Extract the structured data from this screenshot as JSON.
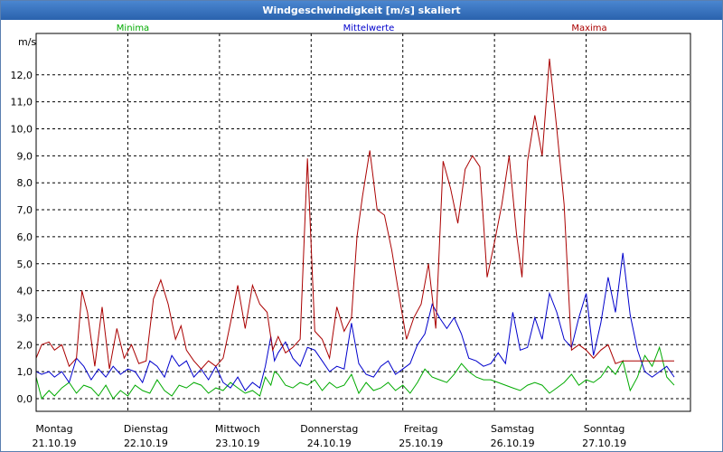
{
  "chart_data": {
    "type": "line",
    "title": "Windgeschwindigkeit [m/s] skaliert",
    "ylabel": "m/s",
    "ylim": [
      0,
      13
    ],
    "yticks": [
      "0,0",
      "1,0",
      "2,0",
      "3,0",
      "4,0",
      "5,0",
      "6,0",
      "7,0",
      "8,0",
      "9,0",
      "10,0",
      "11,0",
      "12,0"
    ],
    "xlim": [
      0,
      7
    ],
    "x_ticks": [
      {
        "day": "Montag",
        "date": "21.10.19"
      },
      {
        "day": "Dienstag",
        "date": "22.10.19"
      },
      {
        "day": "Mittwoch",
        "date": "23.10.19"
      },
      {
        "day": "Donnerstag",
        "date": "24.10.19"
      },
      {
        "day": "Freitag",
        "date": "25.10.19"
      },
      {
        "day": "Samstag",
        "date": "26.10.19"
      },
      {
        "day": "Sonntag",
        "date": "27.10.19"
      }
    ],
    "grid": true,
    "legend_placement": "top",
    "series": [
      {
        "name": "Minima",
        "color": "#00aa00",
        "x": [
          0,
          0.06,
          0.14,
          0.2,
          0.28,
          0.36,
          0.44,
          0.52,
          0.6,
          0.68,
          0.76,
          0.84,
          0.92,
          1,
          1.08,
          1.16,
          1.24,
          1.32,
          1.4,
          1.48,
          1.56,
          1.64,
          1.72,
          1.8,
          1.88,
          1.96,
          2.04,
          2.12,
          2.2,
          2.28,
          2.36,
          2.44,
          2.5,
          2.56,
          2.6,
          2.64,
          2.72,
          2.8,
          2.88,
          2.96,
          3.04,
          3.12,
          3.2,
          3.28,
          3.36,
          3.44,
          3.52,
          3.6,
          3.68,
          3.76,
          3.84,
          3.92,
          4,
          4.08,
          4.16,
          4.24,
          4.32,
          4.4,
          4.48,
          4.56,
          4.64,
          4.72,
          4.8,
          4.88,
          4.96,
          5.04,
          5.12,
          5.2,
          5.28,
          5.36,
          5.44,
          5.52,
          5.6,
          5.68,
          5.76,
          5.84,
          5.92,
          6,
          6.08,
          6.16,
          6.24,
          6.32,
          6.4,
          6.48,
          6.56,
          6.64,
          6.72,
          6.8,
          6.88,
          6.96
        ],
        "y": [
          0.8,
          0,
          0.3,
          0.1,
          0.4,
          0.6,
          0.2,
          0.5,
          0.4,
          0.1,
          0.5,
          0,
          0.3,
          0.1,
          0.5,
          0.3,
          0.2,
          0.7,
          0.3,
          0.1,
          0.5,
          0.4,
          0.6,
          0.5,
          0.2,
          0.4,
          0.3,
          0.6,
          0.4,
          0.2,
          0.3,
          0.1,
          0.8,
          0.5,
          1.0,
          0.9,
          0.5,
          0.4,
          0.6,
          0.5,
          0.7,
          0.3,
          0.6,
          0.4,
          0.5,
          0.9,
          0.2,
          0.6,
          0.3,
          0.4,
          0.6,
          0.3,
          0.5,
          0.2,
          0.6,
          1.1,
          0.8,
          0.7,
          0.6,
          0.9,
          1.3,
          1.0,
          0.8,
          0.7,
          0.7,
          0.6,
          0.5,
          0.4,
          0.3,
          0.5,
          0.6,
          0.5,
          0.2,
          0.4,
          0.6,
          0.9,
          0.5,
          0.7,
          0.6,
          0.8,
          1.2,
          0.9,
          1.4,
          0.3,
          0.8,
          1.6,
          1.2,
          1.9,
          0.8,
          0.5
        ]
      },
      {
        "name": "Mittelwerte",
        "color": "#0000cc",
        "x": [
          0,
          0.06,
          0.14,
          0.2,
          0.28,
          0.36,
          0.44,
          0.52,
          0.6,
          0.68,
          0.76,
          0.84,
          0.92,
          1,
          1.08,
          1.16,
          1.24,
          1.32,
          1.4,
          1.48,
          1.56,
          1.64,
          1.72,
          1.8,
          1.88,
          1.96,
          2.04,
          2.12,
          2.2,
          2.28,
          2.36,
          2.44,
          2.5,
          2.56,
          2.6,
          2.64,
          2.72,
          2.8,
          2.88,
          2.96,
          3.04,
          3.12,
          3.2,
          3.28,
          3.36,
          3.44,
          3.52,
          3.6,
          3.68,
          3.76,
          3.84,
          3.92,
          4,
          4.08,
          4.16,
          4.24,
          4.32,
          4.4,
          4.48,
          4.56,
          4.64,
          4.72,
          4.8,
          4.88,
          4.96,
          5.04,
          5.12,
          5.2,
          5.28,
          5.36,
          5.44,
          5.52,
          5.6,
          5.68,
          5.76,
          5.84,
          5.92,
          6,
          6.08,
          6.16,
          6.24,
          6.32,
          6.4,
          6.48,
          6.56,
          6.64,
          6.72,
          6.8,
          6.88,
          6.96
        ],
        "y": [
          1.0,
          0.9,
          1.0,
          0.8,
          1.0,
          0.6,
          1.5,
          1.2,
          0.7,
          1.1,
          0.8,
          1.2,
          0.9,
          1.1,
          1.0,
          0.6,
          1.4,
          1.2,
          0.8,
          1.6,
          1.2,
          1.4,
          0.8,
          1.1,
          0.7,
          1.2,
          0.6,
          0.4,
          0.8,
          0.3,
          0.6,
          0.4,
          1.2,
          2.3,
          1.4,
          1.7,
          2.1,
          1.5,
          1.2,
          1.9,
          1.8,
          1.4,
          1.0,
          1.2,
          1.1,
          2.8,
          1.3,
          0.9,
          0.8,
          1.2,
          1.4,
          0.9,
          1.1,
          1.3,
          2.0,
          2.4,
          3.5,
          3.0,
          2.6,
          3.0,
          2.4,
          1.5,
          1.4,
          1.2,
          1.3,
          1.7,
          1.3,
          3.2,
          1.8,
          1.9,
          3.0,
          2.2,
          3.9,
          3.2,
          2.2,
          1.9,
          3.0,
          3.9,
          1.6,
          2.8,
          4.5,
          3.2,
          5.4,
          3.1,
          1.8,
          1.0,
          0.8,
          1.0,
          1.2,
          0.8
        ]
      },
      {
        "name": "Maxima",
        "color": "#aa0000",
        "x": [
          0,
          0.06,
          0.14,
          0.2,
          0.28,
          0.36,
          0.44,
          0.5,
          0.56,
          0.64,
          0.72,
          0.8,
          0.88,
          0.96,
          1.04,
          1.12,
          1.2,
          1.28,
          1.36,
          1.44,
          1.52,
          1.58,
          1.64,
          1.72,
          1.8,
          1.88,
          1.96,
          2.04,
          2.12,
          2.2,
          2.28,
          2.36,
          2.44,
          2.52,
          2.58,
          2.64,
          2.72,
          2.8,
          2.88,
          2.96,
          3.04,
          3.12,
          3.2,
          3.28,
          3.36,
          3.44,
          3.5,
          3.56,
          3.64,
          3.72,
          3.8,
          3.88,
          3.96,
          4.04,
          4.12,
          4.2,
          4.28,
          4.36,
          4.44,
          4.52,
          4.6,
          4.68,
          4.76,
          4.84,
          4.92,
          5.0,
          5.08,
          5.16,
          5.24,
          5.3,
          5.36,
          5.44,
          5.52,
          5.6,
          5.68,
          5.76,
          5.84,
          5.92,
          6.0,
          6.08,
          6.16,
          6.24,
          6.32,
          6.4,
          6.48,
          6.56,
          6.64,
          6.72,
          6.8,
          6.88,
          6.96
        ],
        "y": [
          1.5,
          2.0,
          2.1,
          1.8,
          2.0,
          1.2,
          1.5,
          4.0,
          3.2,
          1.2,
          3.4,
          1.1,
          2.6,
          1.5,
          2.0,
          1.3,
          1.4,
          3.7,
          4.4,
          3.5,
          2.2,
          2.7,
          1.8,
          1.4,
          1.1,
          1.4,
          1.2,
          1.5,
          2.8,
          4.2,
          2.6,
          4.2,
          3.5,
          3.2,
          1.8,
          2.3,
          1.7,
          1.9,
          2.2,
          8.9,
          2.5,
          2.2,
          1.5,
          3.4,
          2.5,
          3.0,
          6.0,
          7.5,
          9.2,
          7.0,
          6.8,
          5.5,
          3.8,
          2.2,
          3.0,
          3.5,
          5.0,
          2.6,
          8.8,
          7.8,
          6.5,
          8.5,
          9.0,
          8.6,
          4.5,
          5.8,
          7.2,
          9.0,
          6.1,
          4.5,
          8.8,
          10.5,
          9.0,
          12.6,
          10.0,
          7.2,
          1.8,
          2.0,
          1.8,
          1.5,
          1.8,
          2.0,
          1.3,
          1.4,
          1.4,
          1.4,
          1.4,
          1.4,
          1.4,
          1.4,
          1.4
        ]
      }
    ]
  }
}
